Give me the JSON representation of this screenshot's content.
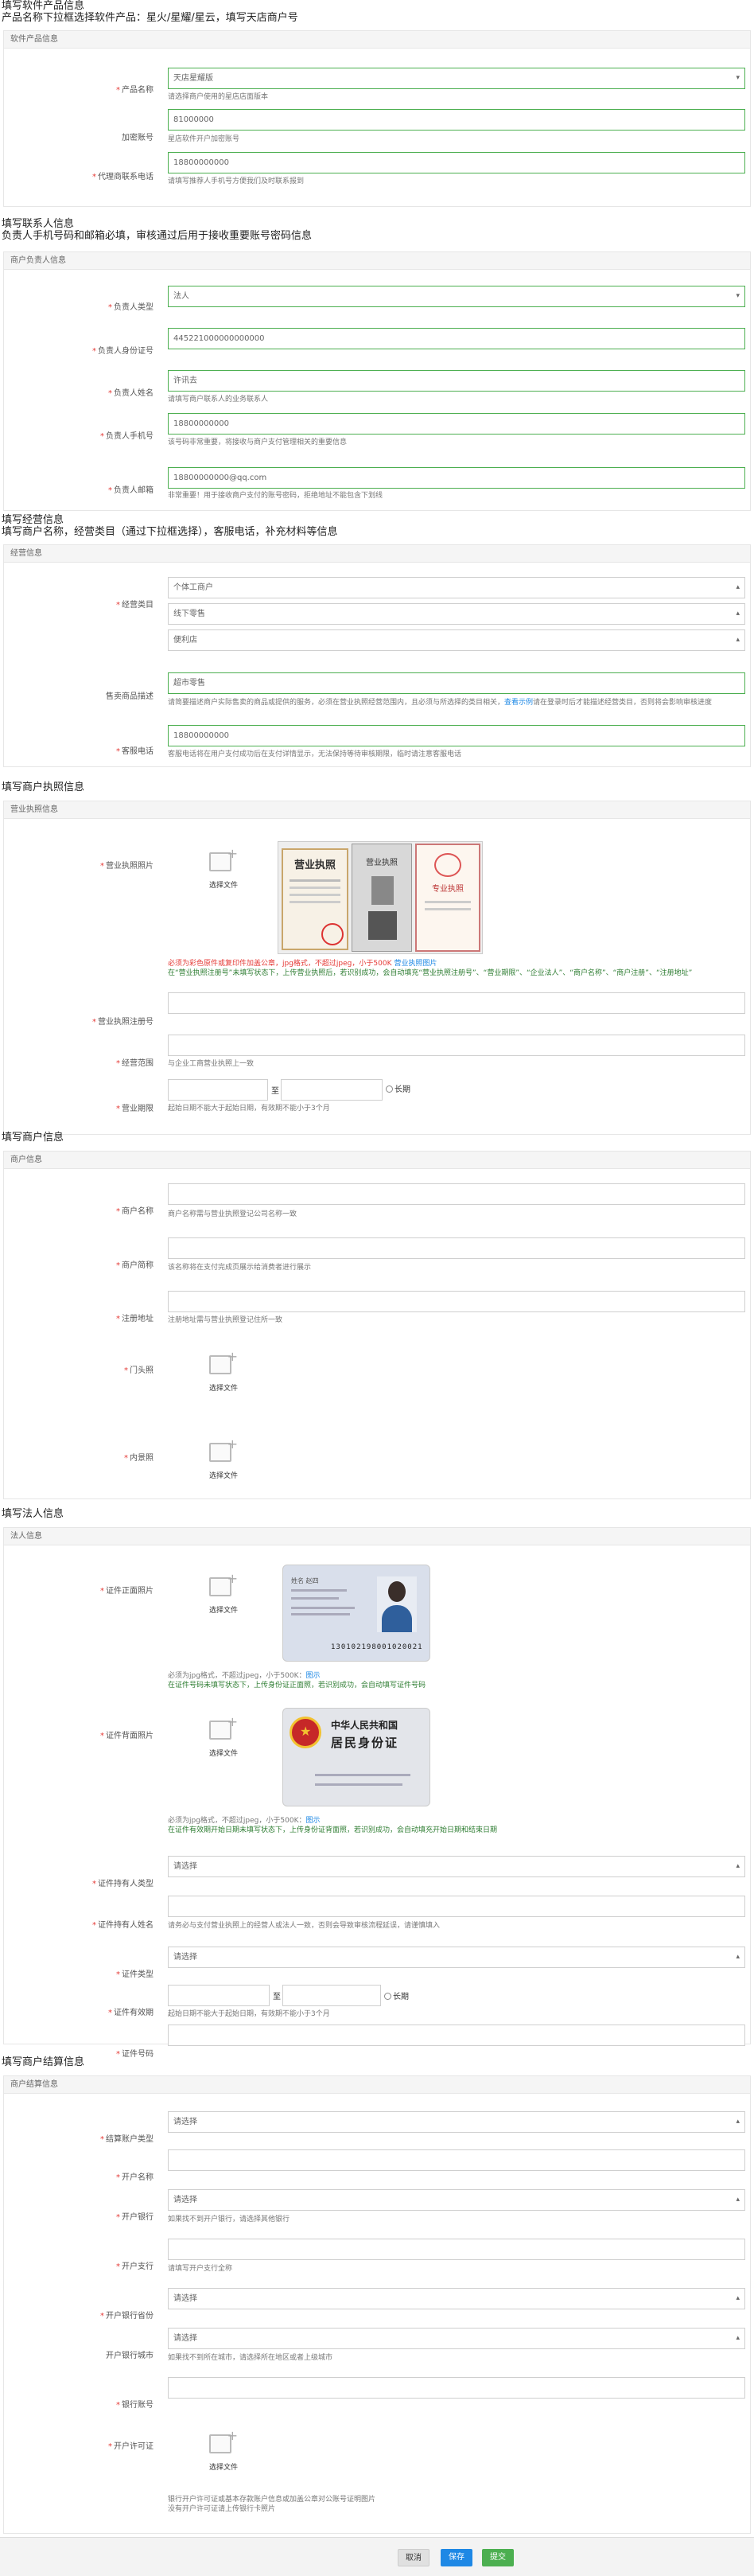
{
  "s1": {
    "title": "填写软件产品信息",
    "sub": "产品名称下拉框选择软件产品：星火/星耀/星云，填写天店商户号",
    "panel": "软件产品信息",
    "f1_label": "产品名称",
    "f1_value": "天店星耀版",
    "f1_hint": "请选择商户使用的星店店面版本",
    "f2_label": "加密账号",
    "f2_value": "81000000",
    "f2_hint": "星店软件开户加密账号",
    "f3_label": "代理商联系电话",
    "f3_value": "18800000000",
    "f3_hint": "请填写推荐人手机号方便我们及时联系报到"
  },
  "s2": {
    "title": "填写联系人信息",
    "sub": "负责人手机号码和邮箱必填，审核通过后用于接收重要账号密码信息",
    "panel": "商户负责人信息",
    "f1_label": "负责人类型",
    "f1_value": "法人",
    "f2_label": "负责人身份证号",
    "f2_value": "445221000000000000",
    "f3_label": "负责人姓名",
    "f3_value": "许讯去",
    "f3_hint": "请填写商户联系人的业务联系人",
    "f4_label": "负责人手机号",
    "f4_value": "18800000000",
    "f4_hint": "该号码非常重要，将接收与商户支付管理相关的重要信息",
    "f5_label": "负责人邮箱",
    "f5_value": "18800000000@qq.com",
    "f5_hint": "非常重要！用于接收商户支付的账号密码，拒绝地址不能包含下划线"
  },
  "s3": {
    "title": "填写经营信息",
    "sub": "填写商户名称，经营类目（通过下拉框选择），客服电话，补充材料等信息",
    "panel": "经营信息",
    "f1_label": "经营类目",
    "f1_v1": "个体工商户",
    "f1_v2": "线下零售",
    "f1_v3": "便利店",
    "f2_label": "售卖商品描述",
    "f2_value": "超市零售",
    "f2_hint_a": "请简要描述商户实际售卖的商品或提供的服务，必须在营业执照经营范围内，且必须与所选择的类目相关，",
    "f2_hint_link": "查看示例",
    "f2_hint_b": "请在登录时后才能描述经营类目，否则将会影响审核进度",
    "f3_label": "客服电话",
    "f3_value": "18800000000",
    "f3_hint": "客服电话将在用户支付成功后在支付详情显示，无法保持等待审核期限，临时请注意客服电话"
  },
  "s4": {
    "title": "填写商户执照信息",
    "panel": "营业执照信息",
    "f1_label": "营业执照照片",
    "upload": "选择文件",
    "f1_hint_red": "必须为彩色原件或复印件加盖公章，jpg格式，不超过jpeg，小于500K",
    "f1_hint_link": "营业执照图片",
    "f1_hint_green": "在“营业执照注册号”未填写状态下，上传营业执照后，若识别成功，会自动填充“营业执照注册号”、“营业期限”、“企业法人”、“商户名称”、“商户注册”、“注册地址”",
    "f2_label": "营业执照注册号",
    "f3_label": "经营范围",
    "f3_hint": "与企业工商营业执照上一致",
    "f4_label": "营业期限",
    "f4_to": "至",
    "f4_long": "长期",
    "f4_hint": "起始日期不能大于起始日期，有效期不能小于3个月"
  },
  "s5": {
    "title": "填写商户信息",
    "panel": "商户信息",
    "f1_label": "商户名称",
    "f1_hint": "商户名称需与营业执照登记公司名称一致",
    "f2_label": "商户简称",
    "f2_hint": "该名称将在支付完成页展示给消费者进行展示",
    "f3_label": "注册地址",
    "f3_hint": "注册地址需与营业执照登记住所一致",
    "f4_label": "门头照",
    "f5_label": "内景照",
    "upload": "选择文件"
  },
  "s6": {
    "title": "填写法人信息",
    "panel": "法人信息",
    "f1_label": "证件正面照片",
    "upload": "选择文件",
    "f1_hint_a": "必须为jpg格式，不超过jpeg，小于500K：",
    "f1_hint_link": "图示",
    "f1_hint_green": "在证件号码未填写状态下，上传身份证正面照，若识别成功，会自动填写证件号码",
    "f2_label": "证件背面照片",
    "f2_hint_a": "必须为jpg格式，不超过jpeg，小于500K：",
    "f2_hint_link": "图示",
    "f2_hint_green": "在证件有效期开始日期未填写状态下，上传身份证背面照，若识别成功，会自动填充开始日期和结束日期",
    "f3_label": "证件持有人类型",
    "f3_value": "请选择",
    "f4_label": "证件持有人姓名",
    "f4_hint": "请务必与支付营业执照上的经营人或法人一致，否则会导致审核流程延误，请谨慎填入",
    "f5_label": "证件类型",
    "f5_value": "请选择",
    "f6_label": "证件有效期",
    "f6_to": "至",
    "f6_long": "长期",
    "f6_hint": "起始日期不能大于起始日期，有效期不能小于3个月",
    "f7_label": "证件号码"
  },
  "s7": {
    "title": "填写商户结算信息",
    "panel": "商户结算信息",
    "f1_label": "结算账户类型",
    "f1_value": "请选择",
    "f2_label": "开户名称",
    "f3_label": "开户银行",
    "f3_value": "请选择",
    "f3_hint": "如果找不到开户银行，请选择其他银行",
    "f4_label": "开户支行",
    "f4_hint": "请填写开户支行全称",
    "f5_label": "开户银行省份",
    "f5_value": "请选择",
    "f6_label": "开户银行城市",
    "f6_value": "请选择",
    "f6_hint": "如果找不到所在城市，请选择所在地区或者上级城市",
    "f7_label": "银行账号",
    "f8_label": "开户许可证",
    "upload": "选择文件",
    "f8_hint1": "银行开户许可证或基本存款账户信息或加盖公章对公账号证明图片",
    "f8_hint2": "没有开户许可证请上传银行卡照片"
  },
  "license": {
    "big": "营业执照",
    "small": "营业执照",
    "special": "专业执照"
  },
  "idcard": {
    "name_label": "姓名",
    "name": "赵四",
    "number": "130102198001020021",
    "country": "中华人民共和国",
    "title": "居民身份证"
  },
  "footer": {
    "cancel": "取消",
    "save": "保存",
    "submit": "提交"
  },
  "colors": {
    "save": "#1e88e5",
    "submit": "#4caf50",
    "required": "#e53935",
    "link": "#1e88e5",
    "hint_green": "#2e7d32"
  }
}
